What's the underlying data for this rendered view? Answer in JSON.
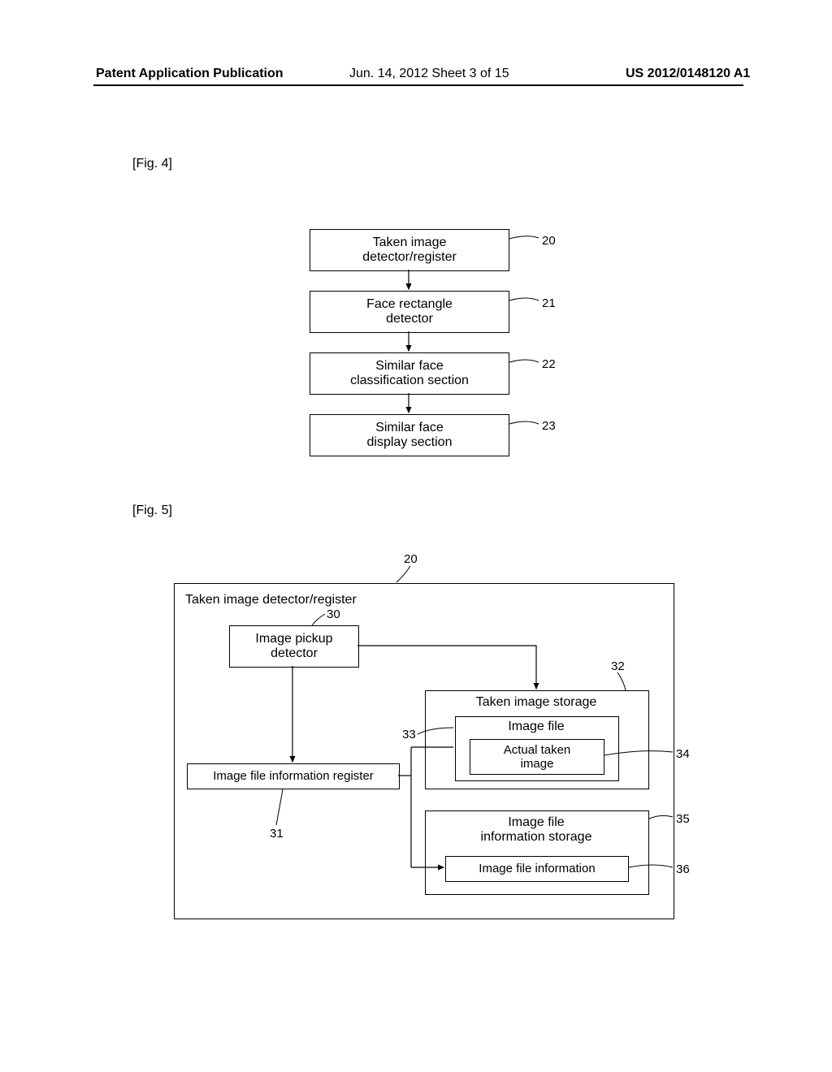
{
  "header": {
    "left": "Patent Application Publication",
    "center": "Jun. 14, 2012   Sheet 3 of 15",
    "right": "US 2012/0148120 A1"
  },
  "fig4": {
    "label": "[Fig. 4]",
    "box20": "Taken image\ndetector/register",
    "box21": "Face rectangle\ndetector",
    "box22": "Similar face\nclassification section",
    "box23": "Similar face\ndisplay section",
    "ref20": "20",
    "ref21": "21",
    "ref22": "22",
    "ref23": "23"
  },
  "fig5": {
    "label": "[Fig. 5]",
    "topref20": "20",
    "outerTitle": "Taken image detector/register",
    "box30": "Image pickup\ndetector",
    "box31": "Image file information register",
    "box32title": "Taken image storage",
    "box33": "Image file",
    "box34": "Actual taken\nimage",
    "box35title": "Image file\ninformation storage",
    "box36": "Image file information",
    "ref30": "30",
    "ref31": "31",
    "ref32": "32",
    "ref33": "33",
    "ref34": "34",
    "ref35": "35",
    "ref36": "36"
  }
}
